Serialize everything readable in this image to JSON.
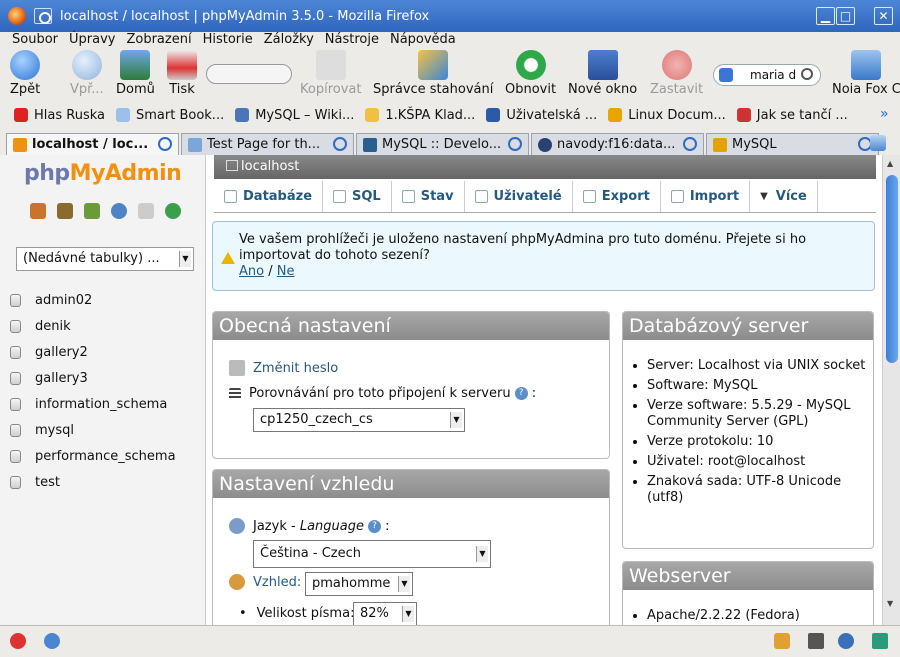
{
  "window": {
    "title": "localhost / localhost | phpMyAdmin 3.5.0 - Mozilla Firefox"
  },
  "menubar": [
    "Soubor",
    "Úpravy",
    "Zobrazení",
    "Historie",
    "Záložky",
    "Nástroje",
    "Nápověda"
  ],
  "toolbar": {
    "back": "Zpět",
    "forward": "Vpř...",
    "home": "Domů",
    "print": "Tisk",
    "copy": "Kopírovat",
    "downloads": "Správce stahování",
    "reload": "Obnovit",
    "new_window": "Nové okno",
    "stop": "Zastavit",
    "search_value": "maria d",
    "noia": "Noia Fox C"
  },
  "bookmarks": [
    "Hlas Ruska",
    "Smart Book...",
    "MySQL – Wiki...",
    "1.KŠPA Klad...",
    "Uživatelská ...",
    "Linux Docum...",
    "Jak se tančí ..."
  ],
  "tabs": [
    "localhost / loc...",
    "Test Page for th...",
    "MySQL :: Develo...",
    "navody:f16:data...",
    "MySQL"
  ],
  "pma": {
    "logo_php": "php",
    "logo_my": "MyAdmin",
    "recent": "(Nedávné tabulky) ...",
    "databases": [
      "admin02",
      "denik",
      "gallery2",
      "gallery3",
      "information_schema",
      "mysql",
      "performance_schema",
      "test"
    ],
    "breadcrumb": "localhost",
    "topmenu": [
      "Databáze",
      "SQL",
      "Stav",
      "Uživatelé",
      "Export",
      "Import",
      "Více"
    ],
    "notice": {
      "line1": "Ve vašem prohlížeči je uloženo nastavení phpMyAdmina pro tuto doménu. Přejete si ho",
      "line2": "importovat do tohoto sezení?",
      "yes": "Ano",
      "sep": " / ",
      "no": "Ne"
    },
    "general": {
      "title": "Obecná nastavení",
      "change_password": "Změnit heslo",
      "collation_label": "Porovnávání pro toto připojení k serveru",
      "collation_value": "cp1250_czech_cs"
    },
    "appearance": {
      "title": "Nastavení vzhledu",
      "language_label": "Jazyk",
      "language_word": "Language",
      "language_value": "Čeština - Czech",
      "theme_label": "Vzhled:",
      "theme_value": "pmahomme",
      "fontsize_label": "Velikost písma:",
      "fontsize_value": "82%"
    },
    "dbserver": {
      "title": "Databázový server",
      "items": [
        "Server: Localhost via UNIX socket",
        "Software: MySQL",
        "Verze software: 5.5.29 - MySQL Community Server (GPL)",
        "Verze protokolu: 10",
        "Uživatel: root@localhost",
        "Znaková sada: UTF-8 Unicode (utf8)"
      ]
    },
    "webserver": {
      "title": "Webserver",
      "items": [
        "Apache/2.2.22 (Fedora)"
      ]
    }
  },
  "colors": {
    "titlebar": "#3a72c8",
    "link": "#235a81",
    "logo_php": "#6c78af",
    "logo_my": "#f29111",
    "panel_header": "#999999"
  }
}
